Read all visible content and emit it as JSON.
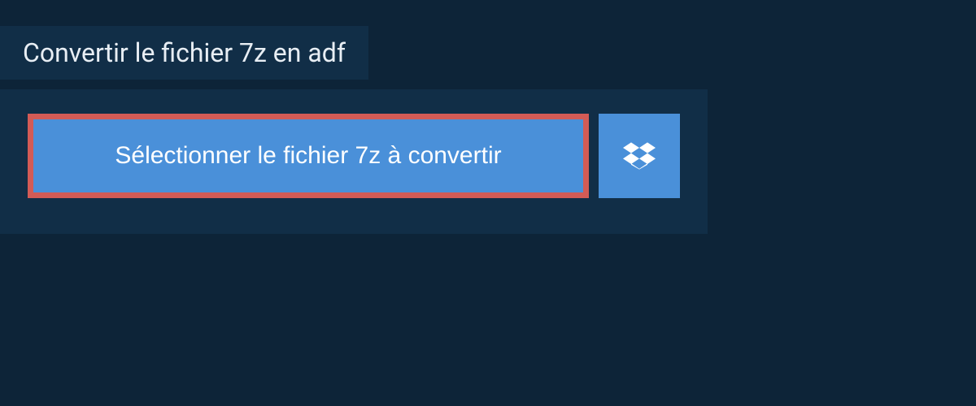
{
  "header": {
    "title": "Convertir le fichier 7z en adf"
  },
  "buttons": {
    "select_file_label": "Sélectionner le fichier 7z à convertir"
  },
  "colors": {
    "background": "#0d2438",
    "panel": "#112e47",
    "button_primary": "#4a90d9",
    "button_highlight_border": "#d35b56",
    "text_light": "#e8eef4",
    "text_white": "#ffffff"
  }
}
